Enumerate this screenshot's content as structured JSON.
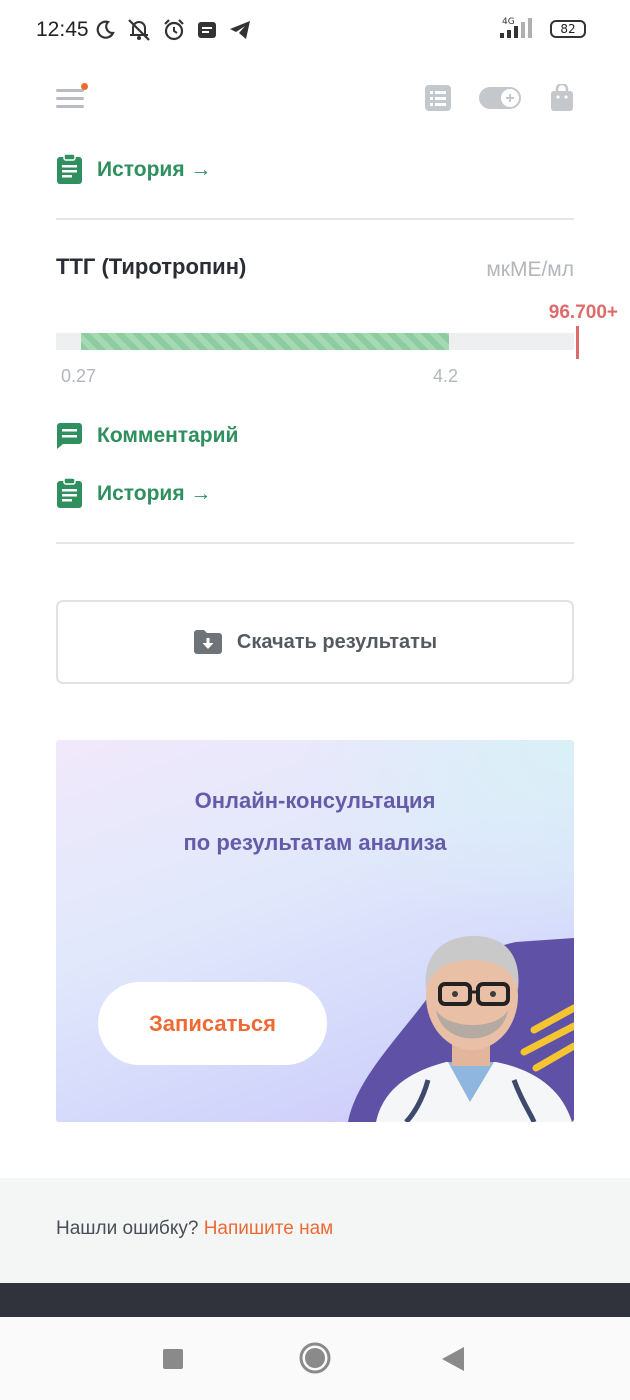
{
  "status_bar": {
    "time": "12:45",
    "network": "4G",
    "battery": "82"
  },
  "header": {
    "menu_icon": "hamburger-menu-icon",
    "actions": [
      "list-icon",
      "toggle-add-icon",
      "bag-icon"
    ]
  },
  "history_top": {
    "label": "История →",
    "icon": "clipboard-icon"
  },
  "analyte": {
    "name": "ТТГ (Тиротропин)",
    "unit": "мкМЕ/мл",
    "value_label": "96.700+",
    "range_low": "0.27",
    "range_high": "4.2",
    "normal_color": "#8ccc9f",
    "alert_color": "#de6b6b",
    "comment_label": "Комментарий",
    "history_label": "История →"
  },
  "download": {
    "label": "Скачать результаты",
    "icon": "folder-download-icon"
  },
  "promo": {
    "title_line1": "Онлайн-консультация",
    "title_line2": "по результатам анализа",
    "button_label": "Записаться",
    "accent_color": "#ee6a35"
  },
  "footer": {
    "question": "Нашли ошибку?",
    "link": "Напишите нам"
  },
  "system_nav": [
    "recent-apps-icon",
    "home-icon",
    "back-icon"
  ]
}
